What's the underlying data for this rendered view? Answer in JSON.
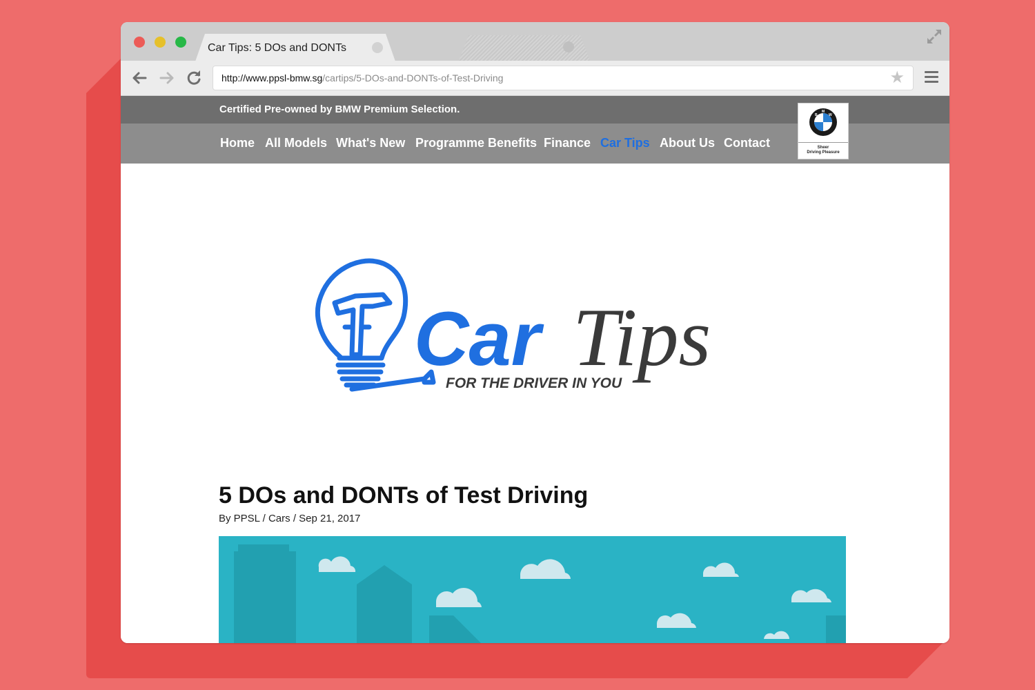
{
  "browser": {
    "tab_title": "Car Tips: 5 DOs and DONTs",
    "url_host": "http://www.ppsl-bmw.sg",
    "url_path": "/cartips/5-DOs-and-DONTs-of-Test-Driving"
  },
  "site": {
    "tagline": "Certified Pre-owned by BMW Premium Selection.",
    "nav": [
      {
        "label": "Home"
      },
      {
        "label": "All Models"
      },
      {
        "label": "What's New"
      },
      {
        "label": "Programme Benefits"
      },
      {
        "label": "Finance"
      },
      {
        "label": "Car Tips",
        "active": true
      },
      {
        "label": "About Us"
      },
      {
        "label": "Contact"
      }
    ],
    "brand_badge": {
      "letters": [
        "B",
        "M",
        "W"
      ],
      "slogan_line1": "Sheer",
      "slogan_line2": "Driving Pleasure"
    },
    "accent_color": "#1f6fe0"
  },
  "logo": {
    "word1": "Car",
    "word2": "Tips",
    "subline": "FOR THE DRIVER IN YOU",
    "blue": "#1f6fe0",
    "dark": "#3a3a3a"
  },
  "article": {
    "title": "5 DOs and DONTs of Test Driving",
    "meta": "By PPSL / Cars / Sep 21, 2017"
  },
  "icons": [
    "back-arrow-icon",
    "forward-arrow-icon",
    "reload-icon",
    "star-icon",
    "menu-icon",
    "fullscreen-icon",
    "bmw-logo-icon",
    "lightbulb-icon"
  ]
}
